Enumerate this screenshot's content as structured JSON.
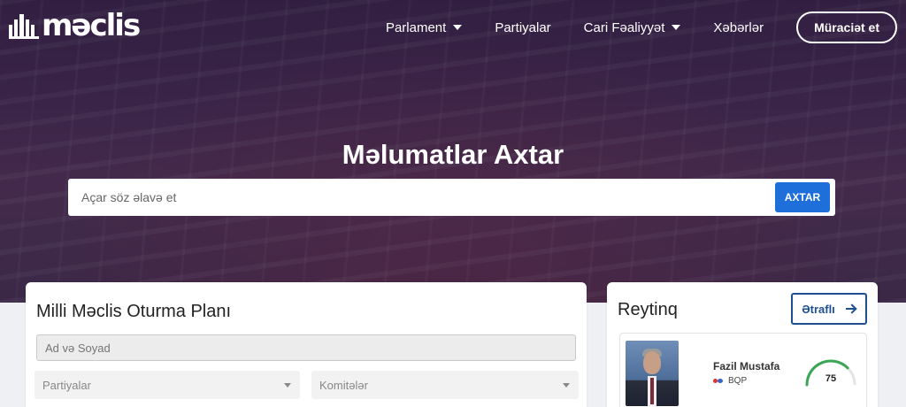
{
  "brand": {
    "logo_text": "məclis"
  },
  "nav": {
    "items": [
      {
        "label": "Parlament",
        "dropdown": true
      },
      {
        "label": "Partiyalar",
        "dropdown": false
      },
      {
        "label": "Cari Fəaliyyət",
        "dropdown": true
      },
      {
        "label": "Xəbərlər",
        "dropdown": false
      }
    ],
    "apply_label": "Müraciət et"
  },
  "hero": {
    "title": "Məlumatlar Axtar",
    "search_placeholder": "Açar söz əlavə et",
    "search_button": "AXTAR"
  },
  "seating": {
    "title": "Milli Məclis Oturma Planı",
    "name_placeholder": "Ad və Soyad",
    "parties_select": "Partiyalar",
    "committees_select": "Komitələr"
  },
  "rating": {
    "title": "Reytinq",
    "more_label": "Ətraflı",
    "top_mp": {
      "name": "Fazil Mustafa",
      "party": "BQP",
      "score": "75",
      "score_fraction": 0.75
    }
  },
  "colors": {
    "accent": "#1e6fd9",
    "outline": "#1e4f91",
    "gauge": "#3aa655"
  }
}
